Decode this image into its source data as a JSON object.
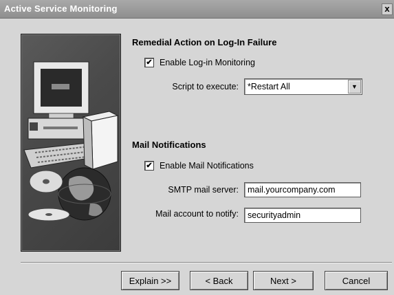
{
  "window": {
    "title": "Active Service Monitoring",
    "close_glyph": "x"
  },
  "remedial": {
    "heading": "Remedial Action on Log-In Failure",
    "enable_checkbox": {
      "label": "Enable Log-in Monitoring",
      "checked": true
    },
    "script_label": "Script to execute:",
    "script_value": "*Restart All"
  },
  "mail": {
    "heading": "Mail Notifications",
    "enable_checkbox": {
      "label": "Enable Mail Notifications",
      "checked": true
    },
    "smtp_label": "SMTP mail server:",
    "smtp_value": "mail.yourcompany.com",
    "account_label": "Mail account to notify:",
    "account_value": "securityadmin"
  },
  "buttons": {
    "explain": "Explain >>",
    "back": "< Back",
    "next": "Next >",
    "cancel": "Cancel"
  },
  "glyphs": {
    "check": "✔",
    "dropdown_arrow": "▼"
  },
  "illustration_icons": [
    "computer-monitor-icon",
    "keyboard-icon",
    "software-box-icon",
    "globe-icon",
    "cd-disc-icon"
  ]
}
